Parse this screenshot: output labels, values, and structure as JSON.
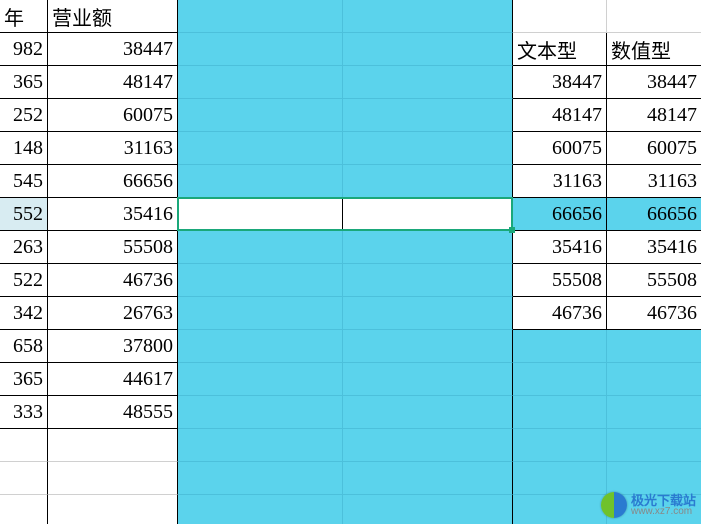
{
  "headers": {
    "colA_partial": "年",
    "colB": "营业额",
    "colE": "文本型",
    "colF": "数值型"
  },
  "left_table": [
    {
      "a": "982",
      "b": "38447"
    },
    {
      "a": "365",
      "b": "48147"
    },
    {
      "a": "252",
      "b": "60075"
    },
    {
      "a": "148",
      "b": "31163"
    },
    {
      "a": "545",
      "b": "66656"
    },
    {
      "a": "552",
      "b": "35416"
    },
    {
      "a": "263",
      "b": "55508"
    },
    {
      "a": "522",
      "b": "46736"
    },
    {
      "a": "342",
      "b": "26763"
    },
    {
      "a": "658",
      "b": "37800"
    },
    {
      "a": "365",
      "b": "44617"
    },
    {
      "a": "333",
      "b": "48555"
    }
  ],
  "right_table": [
    {
      "e": "38447",
      "f": "38447"
    },
    {
      "e": "48147",
      "f": "48147"
    },
    {
      "e": "60075",
      "f": "60075"
    },
    {
      "e": "31163",
      "f": "31163"
    },
    {
      "e": "66656",
      "f": "66656"
    },
    {
      "e": "35416",
      "f": "35416"
    },
    {
      "e": "55508",
      "f": "55508"
    },
    {
      "e": "46736",
      "f": "46736"
    }
  ],
  "selection": {
    "active_row_index": 6,
    "highlighted_right_row_index": 4,
    "selected_columns": [
      "C",
      "D"
    ]
  },
  "watermark": {
    "name": "极光下载站",
    "url": "www.xz7.com"
  }
}
